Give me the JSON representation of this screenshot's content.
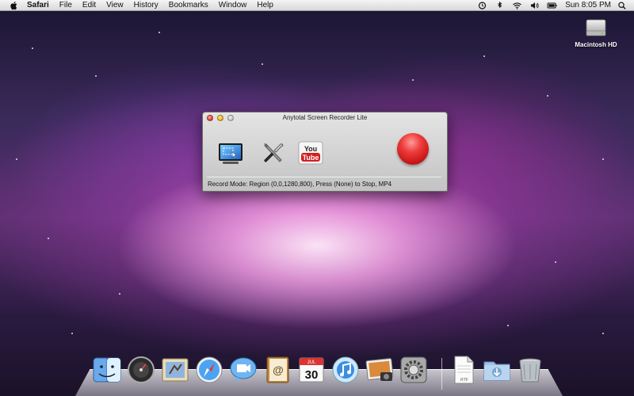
{
  "menubar": {
    "app_name": "Safari",
    "items": [
      "File",
      "Edit",
      "View",
      "History",
      "Bookmarks",
      "Window",
      "Help"
    ],
    "clock": "Sun 8:05 PM"
  },
  "desktop": {
    "drive_label": "Macintosh HD"
  },
  "window": {
    "title": "Anytotal Screen Recorder Lite",
    "youtube_text_top": "You",
    "youtube_text_bottom": "Tube",
    "status": "Record Mode: Region (0,0,1280,800), Press (None) to Stop, MP4"
  },
  "dock": {
    "calendar_day": "30",
    "calendar_month": "JUL",
    "rtf_label": "RTF"
  }
}
